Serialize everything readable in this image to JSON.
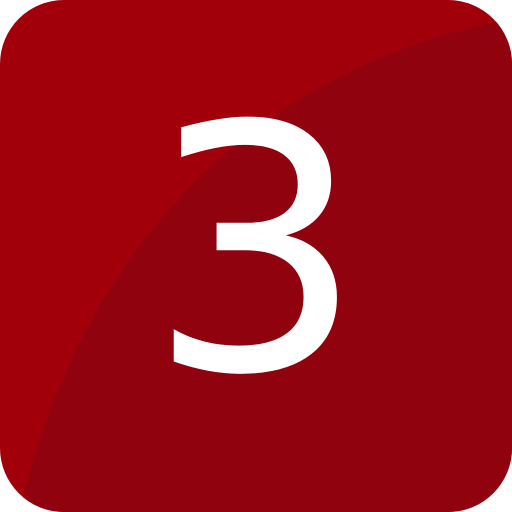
{
  "icon": {
    "digit": "3",
    "colors": {
      "tile_light": "#a1000b",
      "tile_dark": "#8f020e",
      "digit": "#ffffff"
    }
  }
}
